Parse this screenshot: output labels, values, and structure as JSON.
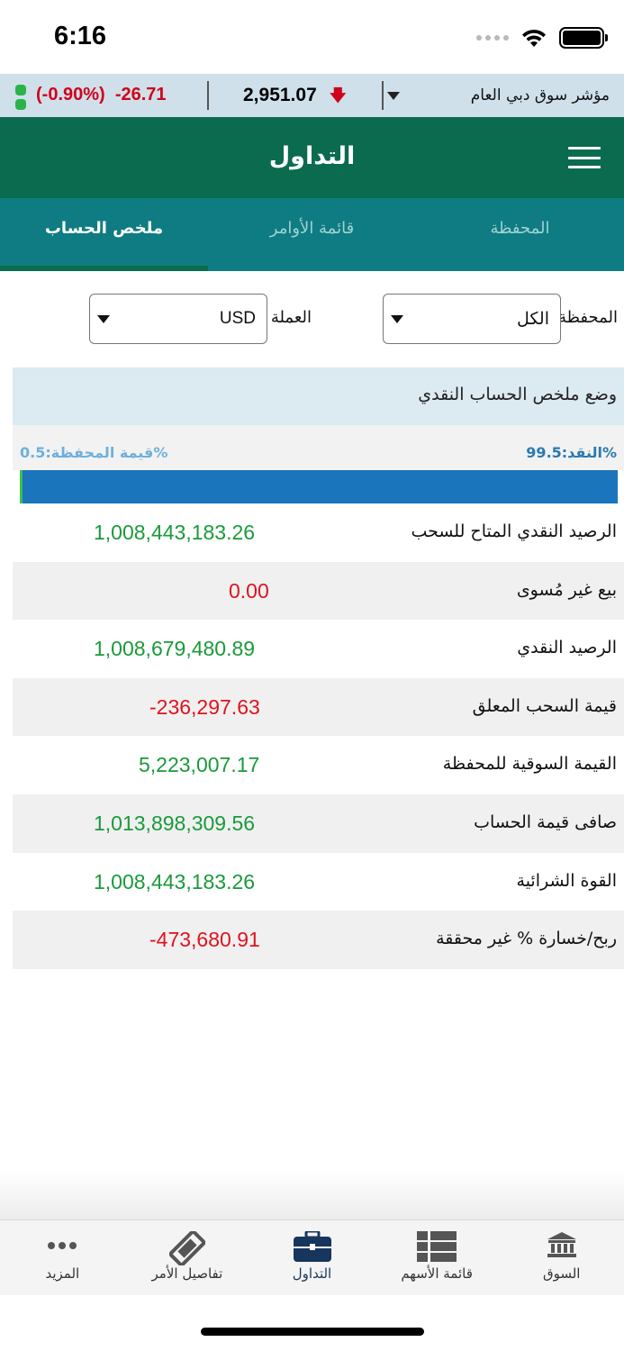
{
  "status_bar": {
    "time": "6:16"
  },
  "ticker": {
    "change": "-26.71",
    "change_pct": "(-0.90%)",
    "value": "2,951.07",
    "name": "مؤشر سوق دبي العام"
  },
  "header": {
    "title": "التداول"
  },
  "tabs": [
    {
      "label": "المحفظة"
    },
    {
      "label": "قائمة الأوامر"
    },
    {
      "label": "ملخص الحساب"
    }
  ],
  "filters": {
    "portfolio_label": "المحفظة",
    "portfolio_value": "الكل",
    "currency_label": "العملة",
    "currency_value": "USD"
  },
  "section": {
    "title": "وضع ملخص الحساب النقدي"
  },
  "ratio": {
    "cash_label": "النقد:99.5%",
    "portfolio_label": "قيمة المحفظة:0.5%",
    "cash_fraction": 0.995,
    "portfolio_fraction": 0.005
  },
  "rows": [
    {
      "label": "الرصيد النقدي المتاح للسحب",
      "value": "1,008,443,183.26",
      "sign": "pos"
    },
    {
      "label": "بيع غير مُسوى",
      "value": "0.00",
      "sign": "neg"
    },
    {
      "label": "الرصيد النقدي",
      "value": "1,008,679,480.89",
      "sign": "pos"
    },
    {
      "label": "قيمة السحب المعلق",
      "value": "-236,297.63",
      "sign": "neg"
    },
    {
      "label": "القيمة السوقية للمحفظة",
      "value": "5,223,007.17",
      "sign": "pos"
    },
    {
      "label": "صافى قيمة الحساب",
      "value": "1,013,898,309.56",
      "sign": "pos"
    },
    {
      "label": "القوة الشرائية",
      "value": "1,008,443,183.26",
      "sign": "pos"
    },
    {
      "label": "ربح/خسارة % غير محققة",
      "value": "-473,680.91",
      "sign": "neg"
    }
  ],
  "bottom_nav": [
    {
      "label": "السوق",
      "icon": "bank-icon"
    },
    {
      "label": "قائمة الأسهم",
      "icon": "list-icon"
    },
    {
      "label": "التداول",
      "icon": "briefcase-icon"
    },
    {
      "label": "تفاصيل الأمر",
      "icon": "ticket-icon"
    },
    {
      "label": "المزيد",
      "icon": "more-icon"
    }
  ],
  "colors": {
    "header": "#0b6b4e",
    "tabs": "#0e7c82",
    "positive": "#1a9a3a",
    "negative": "#e0121e",
    "progress": "#1b75bc"
  }
}
